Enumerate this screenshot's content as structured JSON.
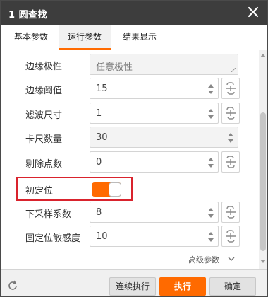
{
  "window": {
    "title": "1 圆查找"
  },
  "tabs": [
    {
      "label": "基本参数",
      "active": false
    },
    {
      "label": "运行参数",
      "active": true
    },
    {
      "label": "结果显示",
      "active": false
    }
  ],
  "params": [
    {
      "label": "边缘极性",
      "value": "任意极性",
      "control": "select"
    },
    {
      "label": "边缘阈值",
      "value": "15",
      "control": "spin-link"
    },
    {
      "label": "滤波尺寸",
      "value": "1",
      "control": "spin-link"
    },
    {
      "label": "卡尺数量",
      "value": "30",
      "control": "spin"
    },
    {
      "label": "剔除点数",
      "value": "0",
      "control": "spin-link"
    }
  ],
  "toggle": {
    "label": "初定位",
    "on": true
  },
  "params2": [
    {
      "label": "下采样系数",
      "value": "8",
      "control": "spin-link"
    },
    {
      "label": "圆定位敏感度",
      "value": "10",
      "control": "spin-link"
    }
  ],
  "advanced": {
    "label": "高级参数"
  },
  "footer": {
    "continuous_label": "连续执行",
    "run_label": "执行",
    "confirm_label": "确定"
  },
  "colors": {
    "accent": "#ff6a00",
    "highlight_border": "#d9232d",
    "titlebar": "#3d3d3d"
  },
  "icons": [
    "close-icon",
    "link-icon",
    "spin-arrows-icon",
    "chevron-down-icon",
    "reset-icon"
  ]
}
